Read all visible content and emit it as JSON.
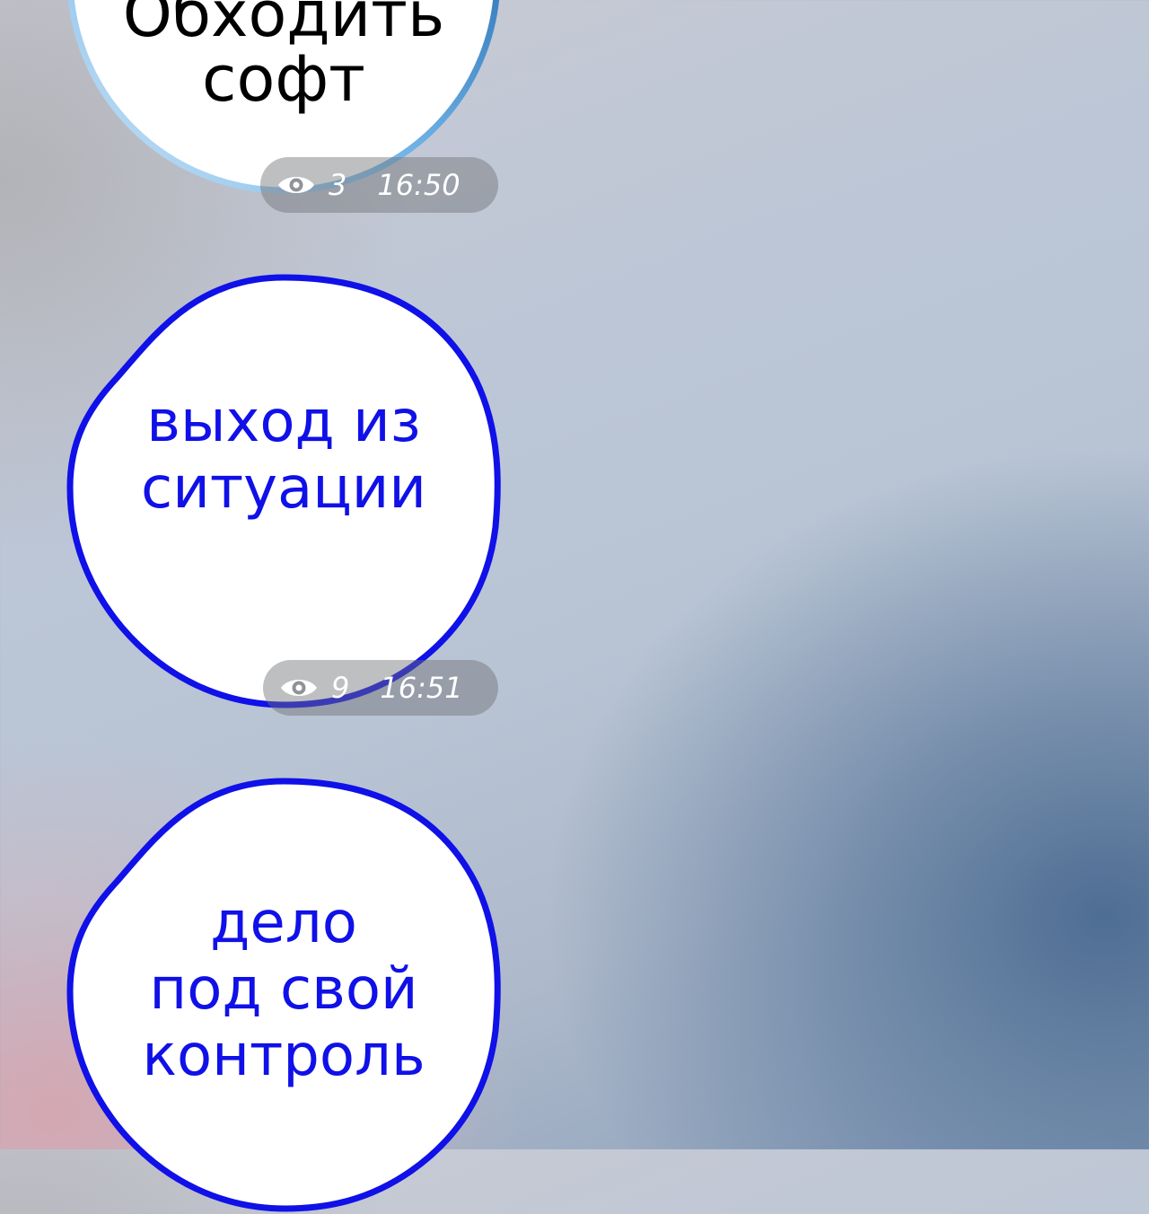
{
  "colors": {
    "msg1_text": "#000000",
    "msg1_ring_light": "#a9d1f0",
    "msg1_ring_dark": "#0a5fb0",
    "ring_blue": "#1010e8",
    "bubble_fill": "#ffffff",
    "meta_text": "#ffffff"
  },
  "messages": [
    {
      "lines": "Обходить\nсофт",
      "views": "3",
      "time": "16:50",
      "icon": "eye-icon"
    },
    {
      "lines": "выход из\nситуации",
      "views": "9",
      "time": "16:51",
      "icon": "eye-icon"
    },
    {
      "lines": "дело\nпод свой\nконтроль"
    }
  ]
}
